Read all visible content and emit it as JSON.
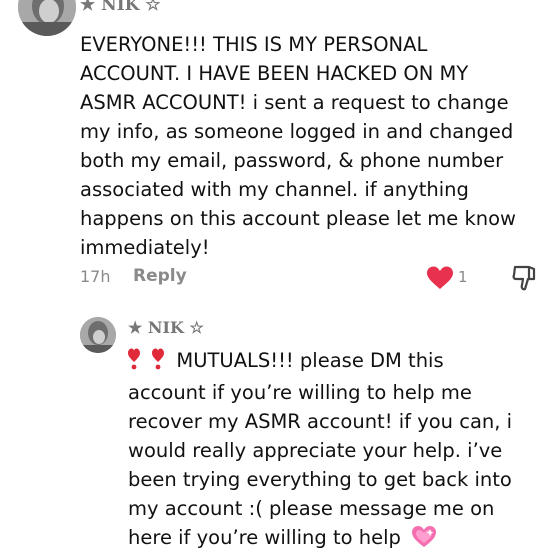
{
  "comment": {
    "username": "★ NIK ☆",
    "lines": [
      "EVERYONE!!! THIS IS MY PERSONAL",
      "ACCOUNT. I HAVE BEEN HACKED ON MY",
      "ASMR ACCOUNT! i sent a request to change",
      "my info, as someone logged in and changed",
      "both my email, password, & phone number",
      "associated with my channel. if anything",
      "happens on this account please let me know",
      "immediately!"
    ],
    "time": "17h",
    "reply_label": "Reply",
    "like_count": "1",
    "liked": true,
    "like_color": "#e8304f"
  },
  "reply": {
    "username": "★ NIK ☆",
    "first_line_text": "MUTUALS!!! please DM this",
    "lines": [
      "account if you’re willing to help me",
      "recover my ASMR account! if you can, i",
      "would really appreciate your help. i’ve",
      "been trying everything to get back into",
      "my account :( please message me on"
    ],
    "last_line_text": "here if you’re willing to help",
    "leading_emoji": "heart-exclamation-icon",
    "trailing_emoji": "sparkling-heart-icon"
  },
  "icons": {
    "like": "heart-icon",
    "dislike": "thumbs-down-icon"
  }
}
